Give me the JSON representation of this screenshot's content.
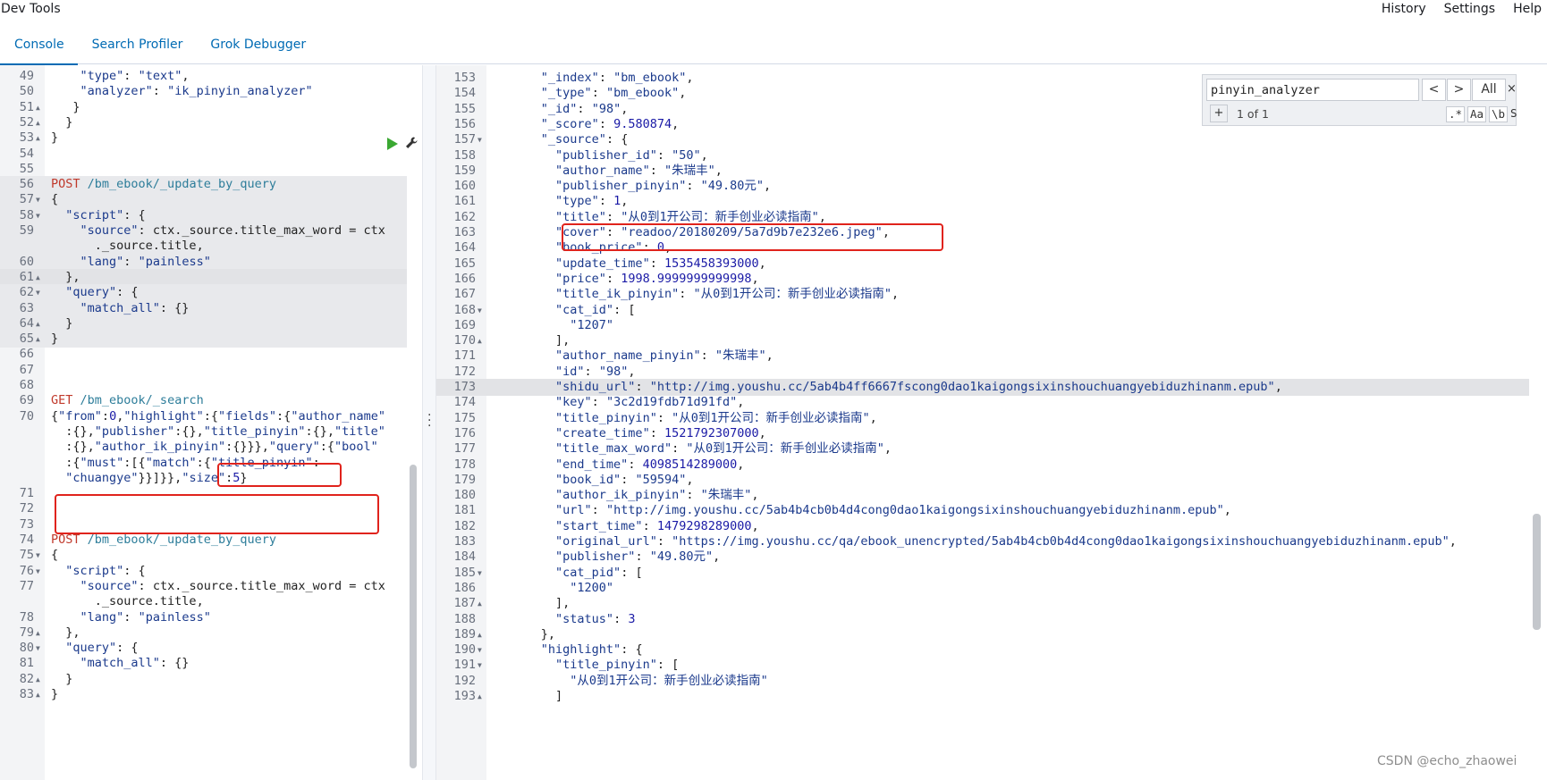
{
  "app": {
    "title": "Dev Tools",
    "top_links": [
      "History",
      "Settings",
      "Help"
    ]
  },
  "tabs": [
    {
      "label": "Console",
      "active": true
    },
    {
      "label": "Search Profiler",
      "active": false
    },
    {
      "label": "Grok Debugger",
      "active": false
    }
  ],
  "search": {
    "query": "pinyin_analyzer",
    "prev": "<",
    "next": ">",
    "all": "All",
    "close": "×",
    "replace_toggle": "+",
    "counter": "1 of 1",
    "regex": ".*",
    "case": "Aa",
    "word": "\\b",
    "selection": "S"
  },
  "left_lines": [
    {
      "n": "49",
      "fold": "",
      "text": "    \"type\": \"text\",",
      "hl": false
    },
    {
      "n": "50",
      "fold": "",
      "text": "    \"analyzer\": \"ik_pinyin_analyzer\"",
      "hl": false
    },
    {
      "n": "51",
      "fold": "▲",
      "text": "   }",
      "hl": false
    },
    {
      "n": "52",
      "fold": "▲",
      "text": "  }",
      "hl": false
    },
    {
      "n": "53",
      "fold": "▲",
      "text": "}",
      "hl": false
    },
    {
      "n": "54",
      "fold": "",
      "text": "",
      "hl": false
    },
    {
      "n": "55",
      "fold": "",
      "text": "",
      "hl": false
    },
    {
      "n": "56",
      "fold": "",
      "text": "POST /bm_ebook/_update_by_query",
      "hl": true,
      "kind": "request"
    },
    {
      "n": "57",
      "fold": "▼",
      "text": "{",
      "hl": true
    },
    {
      "n": "58",
      "fold": "▼",
      "text": "  \"script\": {",
      "hl": true
    },
    {
      "n": "59",
      "fold": "",
      "text": "    \"source\": \"ctx._source.title_max_word = ctx",
      "hl": true
    },
    {
      "n": "",
      "fold": "",
      "text": "      ._source.title\",",
      "hl": true
    },
    {
      "n": "60",
      "fold": "",
      "text": "    \"lang\": \"painless\"",
      "hl": true
    },
    {
      "n": "61",
      "fold": "▲",
      "text": "  },",
      "hl": true,
      "cur": true
    },
    {
      "n": "62",
      "fold": "▼",
      "text": "  \"query\": {",
      "hl": true
    },
    {
      "n": "63",
      "fold": "",
      "text": "    \"match_all\": {}",
      "hl": true
    },
    {
      "n": "64",
      "fold": "▲",
      "text": "  }",
      "hl": true
    },
    {
      "n": "65",
      "fold": "▲",
      "text": "}",
      "hl": true
    },
    {
      "n": "66",
      "fold": "",
      "text": "",
      "hl": false
    },
    {
      "n": "67",
      "fold": "",
      "text": "",
      "hl": false
    },
    {
      "n": "68",
      "fold": "",
      "text": "",
      "hl": false
    },
    {
      "n": "69",
      "fold": "",
      "text": "GET /bm_ebook/_search",
      "hl": false,
      "kind": "request"
    },
    {
      "n": "70",
      "fold": "",
      "text": "{\"from\":0,\"highlight\":{\"fields\":{\"author_name\"",
      "hl": false
    },
    {
      "n": "",
      "fold": "",
      "text": "  :{},\"publisher\":{},\"title_pinyin\":{},\"title\"",
      "hl": false
    },
    {
      "n": "",
      "fold": "",
      "text": "  :{},\"author_ik_pinyin\":{}}},\"query\":{\"bool\"",
      "hl": false
    },
    {
      "n": "",
      "fold": "",
      "text": "  :{\"must\":[{\"match\":{\"title_pinyin\":",
      "hl": false
    },
    {
      "n": "",
      "fold": "",
      "text": "  \"chuangye\"}}]}},\"size\":5}",
      "hl": false
    },
    {
      "n": "71",
      "fold": "",
      "text": "",
      "hl": false
    },
    {
      "n": "72",
      "fold": "",
      "text": "",
      "hl": false
    },
    {
      "n": "73",
      "fold": "",
      "text": "",
      "hl": false
    },
    {
      "n": "74",
      "fold": "",
      "text": "POST /bm_ebook/_update_by_query",
      "hl": false,
      "kind": "request"
    },
    {
      "n": "75",
      "fold": "▼",
      "text": "{",
      "hl": false
    },
    {
      "n": "76",
      "fold": "▼",
      "text": "  \"script\": {",
      "hl": false
    },
    {
      "n": "77",
      "fold": "",
      "text": "    \"source\": \"ctx._source.title_max_word = ctx",
      "hl": false
    },
    {
      "n": "",
      "fold": "",
      "text": "      ._source.title\",",
      "hl": false
    },
    {
      "n": "78",
      "fold": "",
      "text": "    \"lang\": \"painless\"",
      "hl": false
    },
    {
      "n": "79",
      "fold": "▲",
      "text": "  },",
      "hl": false
    },
    {
      "n": "80",
      "fold": "▼",
      "text": "  \"query\": {",
      "hl": false
    },
    {
      "n": "81",
      "fold": "",
      "text": "    \"match_all\": {}",
      "hl": false
    },
    {
      "n": "82",
      "fold": "▲",
      "text": "  }",
      "hl": false
    },
    {
      "n": "83",
      "fold": "▲",
      "text": "}",
      "hl": false
    }
  ],
  "right_lines": [
    {
      "n": "153",
      "fold": "",
      "text": "      \"_index\": \"bm_ebook\","
    },
    {
      "n": "154",
      "fold": "",
      "text": "      \"_type\": \"bm_ebook\","
    },
    {
      "n": "155",
      "fold": "",
      "text": "      \"_id\": \"98\","
    },
    {
      "n": "156",
      "fold": "",
      "text": "      \"_score\": 9.580874,"
    },
    {
      "n": "157",
      "fold": "▼",
      "text": "      \"_source\": {"
    },
    {
      "n": "158",
      "fold": "",
      "text": "        \"publisher_id\": \"50\","
    },
    {
      "n": "159",
      "fold": "",
      "text": "        \"author_name\": \"朱瑞丰\","
    },
    {
      "n": "160",
      "fold": "",
      "text": "        \"publisher_pinyin\": \"49.80元\","
    },
    {
      "n": "161",
      "fold": "",
      "text": "        \"type\": 1,"
    },
    {
      "n": "162",
      "fold": "",
      "text": "        \"title\": \"从0到1开公司：新手创业必读指南\","
    },
    {
      "n": "163",
      "fold": "",
      "text": "        \"cover\": \"readoo/20180209/5a7d9b7e232e6.jpeg\","
    },
    {
      "n": "164",
      "fold": "",
      "text": "        \"book_price\": 0,"
    },
    {
      "n": "165",
      "fold": "",
      "text": "        \"update_time\": 1535458393000,"
    },
    {
      "n": "166",
      "fold": "",
      "text": "        \"price\": 1998.9999999999998,"
    },
    {
      "n": "167",
      "fold": "",
      "text": "        \"title_ik_pinyin\": \"从0到1开公司：新手创业必读指南\","
    },
    {
      "n": "168",
      "fold": "▼",
      "text": "        \"cat_id\": ["
    },
    {
      "n": "169",
      "fold": "",
      "text": "          \"1207\""
    },
    {
      "n": "170",
      "fold": "▲",
      "text": "        ],"
    },
    {
      "n": "171",
      "fold": "",
      "text": "        \"author_name_pinyin\": \"朱瑞丰\","
    },
    {
      "n": "172",
      "fold": "",
      "text": "        \"id\": \"98\","
    },
    {
      "n": "173",
      "fold": "",
      "text": "        \"shidu_url\": \"http://img.youshu.cc/5ab4b4ff6667fscong0dao1kaigongsixinshouchuangyebiduzhinanm.epub\",",
      "cur": true
    },
    {
      "n": "174",
      "fold": "",
      "text": "        \"key\": \"3c2d19fdb71d91fd\","
    },
    {
      "n": "175",
      "fold": "",
      "text": "        \"title_pinyin\": \"从0到1开公司：新手创业必读指南\","
    },
    {
      "n": "176",
      "fold": "",
      "text": "        \"create_time\": 1521792307000,"
    },
    {
      "n": "177",
      "fold": "",
      "text": "        \"title_max_word\": \"从0到1开公司：新手创业必读指南\","
    },
    {
      "n": "178",
      "fold": "",
      "text": "        \"end_time\": 4098514289000,"
    },
    {
      "n": "179",
      "fold": "",
      "text": "        \"book_id\": \"59594\","
    },
    {
      "n": "180",
      "fold": "",
      "text": "        \"author_ik_pinyin\": \"朱瑞丰\","
    },
    {
      "n": "181",
      "fold": "",
      "text": "        \"url\": \"http://img.youshu.cc/5ab4b4cb0b4d4cong0dao1kaigongsixinshouchuangyebiduzhinanm.epub\","
    },
    {
      "n": "182",
      "fold": "",
      "text": "        \"start_time\": 1479298289000,"
    },
    {
      "n": "183",
      "fold": "",
      "text": "        \"original_url\": \"https://img.youshu.cc/qa/ebook_unencrypted/5ab4b4cb0b4d4cong0dao1kaigongsixinshouchuangyebiduzhinanm.epub\","
    },
    {
      "n": "184",
      "fold": "",
      "text": "        \"publisher\": \"49.80元\","
    },
    {
      "n": "185",
      "fold": "▼",
      "text": "        \"cat_pid\": ["
    },
    {
      "n": "186",
      "fold": "",
      "text": "          \"1200\""
    },
    {
      "n": "187",
      "fold": "▲",
      "text": "        ],"
    },
    {
      "n": "188",
      "fold": "",
      "text": "        \"status\": 3"
    },
    {
      "n": "189",
      "fold": "▲",
      "text": "      },"
    },
    {
      "n": "190",
      "fold": "▼",
      "text": "      \"highlight\": {"
    },
    {
      "n": "191",
      "fold": "▼",
      "text": "        \"title_pinyin\": ["
    },
    {
      "n": "192",
      "fold": "",
      "text": "          \"从0到1开公司：新手创业必读指南\""
    },
    {
      "n": "193",
      "fold": "▲",
      "text": "        ]"
    }
  ],
  "watermark": "CSDN @echo_zhaowei",
  "colors": {
    "accent": "#006bb4",
    "annotation": "#e0231c",
    "run": "#3aa832"
  }
}
